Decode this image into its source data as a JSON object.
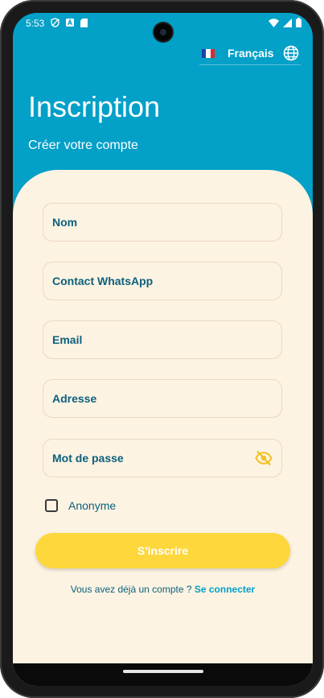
{
  "status_bar": {
    "time": "5:53"
  },
  "language": {
    "flag_colors": [
      "#1d3fa8",
      "#ffffff",
      "#e0292d"
    ],
    "label": "Français"
  },
  "header": {
    "title": "Inscription",
    "subtitle": "Créer votre compte"
  },
  "form": {
    "fields": [
      {
        "label": "Nom"
      },
      {
        "label": "Contact WhatsApp"
      },
      {
        "label": "Email"
      },
      {
        "label": "Adresse"
      },
      {
        "label": "Mot de passe"
      }
    ],
    "anonymous_label": "Anonyme",
    "anonymous_checked": false,
    "submit_label": "S'inscrire"
  },
  "login": {
    "prompt": "Vous avez déjà un compte ? ",
    "link": "Se connecter"
  },
  "colors": {
    "primary": "#03A0C8",
    "background": "#FCF3E2",
    "accent": "#FED73C",
    "text": "#0D607E"
  }
}
